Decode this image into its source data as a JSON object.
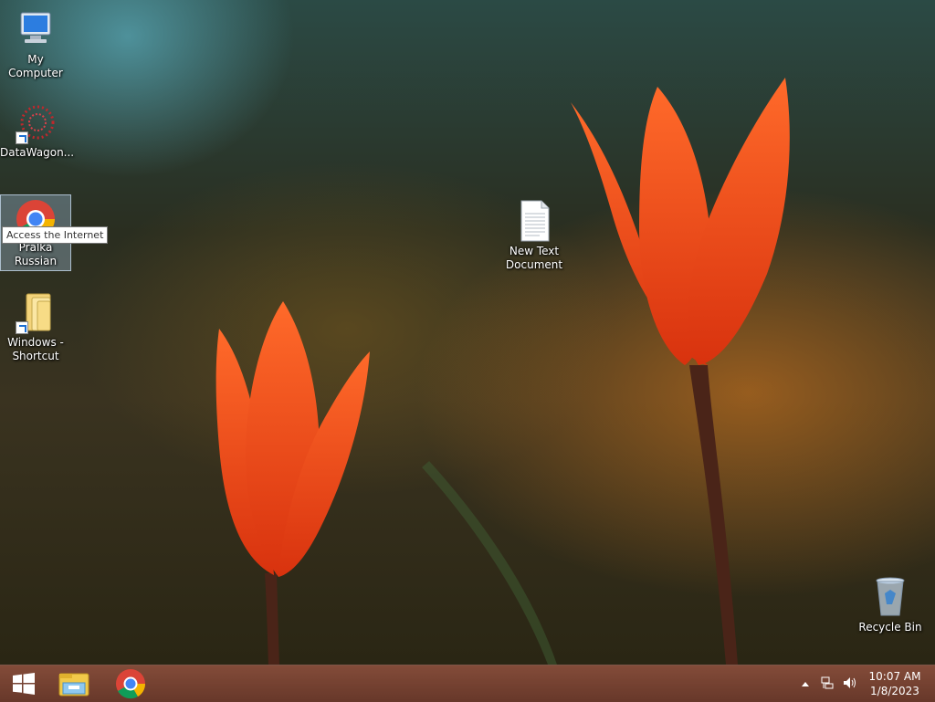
{
  "desktop": {
    "icons": [
      {
        "label": "My Computer",
        "icon": "computer-icon"
      },
      {
        "label": "DataWagon...",
        "icon": "datawagon-icon"
      },
      {
        "label": "Pralka Russian",
        "icon": "chrome-icon"
      },
      {
        "label": "Windows - Shortcut",
        "icon": "folder-icon"
      },
      {
        "label": "New Text Document",
        "icon": "text-file-icon"
      },
      {
        "label": "Recycle Bin",
        "icon": "recycle-bin-icon"
      }
    ],
    "tooltip": "Access the Internet",
    "selected_icon": "Pralka Russian"
  },
  "taskbar": {
    "start_icon": "windows-start-icon",
    "pinned": [
      {
        "name": "File Explorer",
        "icon": "file-explorer-icon"
      },
      {
        "name": "Google Chrome",
        "icon": "chrome-icon"
      }
    ],
    "tray": {
      "icons": [
        "show-hidden-icons-icon",
        "network-icon",
        "volume-icon"
      ],
      "time": "10:07 AM",
      "date": "1/8/2023"
    }
  },
  "colors": {
    "taskbar": "#6e3526",
    "tulip": "#ff5a1e"
  }
}
